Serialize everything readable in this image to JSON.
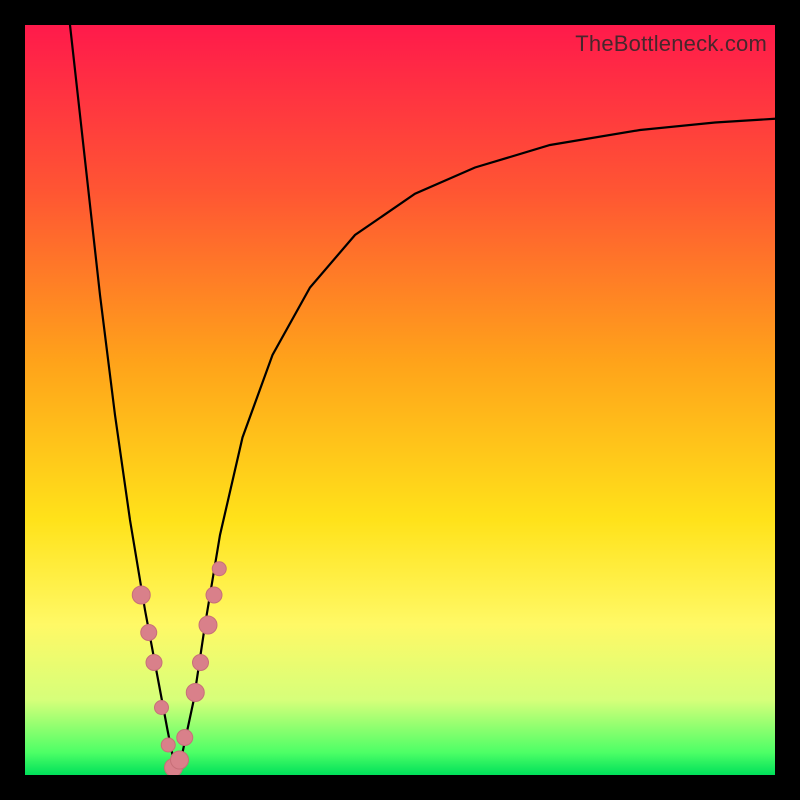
{
  "watermark": "TheBottleneck.com",
  "colors": {
    "frame": "#000000",
    "curve": "#000000",
    "markerFill": "#d9808a",
    "markerStroke": "#c76f78",
    "gradient_stops": [
      {
        "offset": 0.0,
        "color": "#ff1a4b"
      },
      {
        "offset": 0.22,
        "color": "#ff5533"
      },
      {
        "offset": 0.45,
        "color": "#ffa31a"
      },
      {
        "offset": 0.66,
        "color": "#ffe21a"
      },
      {
        "offset": 0.8,
        "color": "#fff966"
      },
      {
        "offset": 0.9,
        "color": "#d6ff7a"
      },
      {
        "offset": 0.97,
        "color": "#4dff66"
      },
      {
        "offset": 1.0,
        "color": "#00e05a"
      }
    ]
  },
  "chart_data": {
    "type": "line",
    "title": "",
    "xlabel": "",
    "ylabel": "",
    "x_range": [
      0,
      100
    ],
    "y_range": [
      0,
      100
    ],
    "note": "Values are read off the plot pixels; x is horizontal position (0=left edge of plot, 100=right edge), y is curve height (0=bottom green baseline, 100=top). Curve is a V / asymmetric cusp bottoming out near x≈20.",
    "series": [
      {
        "name": "bottleneck-curve",
        "x": [
          6.0,
          8.0,
          10.0,
          12.0,
          14.0,
          16.0,
          17.5,
          19.0,
          20.0,
          21.0,
          22.5,
          24.0,
          26.0,
          29.0,
          33.0,
          38.0,
          44.0,
          52.0,
          60.0,
          70.0,
          82.0,
          92.0,
          100.0
        ],
        "y": [
          100.0,
          82.0,
          64.0,
          48.0,
          34.0,
          22.0,
          14.0,
          6.0,
          1.0,
          3.0,
          10.0,
          20.0,
          32.0,
          45.0,
          56.0,
          65.0,
          72.0,
          77.5,
          81.0,
          84.0,
          86.0,
          87.0,
          87.5
        ]
      }
    ],
    "markers": {
      "name": "highlighted-points",
      "description": "Salmon circular markers clustered near the trough of the V on both branches.",
      "x": [
        15.5,
        16.5,
        17.2,
        18.2,
        19.1,
        19.8,
        20.6,
        21.3,
        22.7,
        23.4,
        24.4,
        25.2,
        25.9
      ],
      "y": [
        24.0,
        19.0,
        15.0,
        9.0,
        4.0,
        1.0,
        2.0,
        5.0,
        11.0,
        15.0,
        20.0,
        24.0,
        27.5
      ],
      "r": [
        9,
        8,
        8,
        7,
        7,
        9,
        9,
        8,
        9,
        8,
        9,
        8,
        7
      ]
    }
  }
}
